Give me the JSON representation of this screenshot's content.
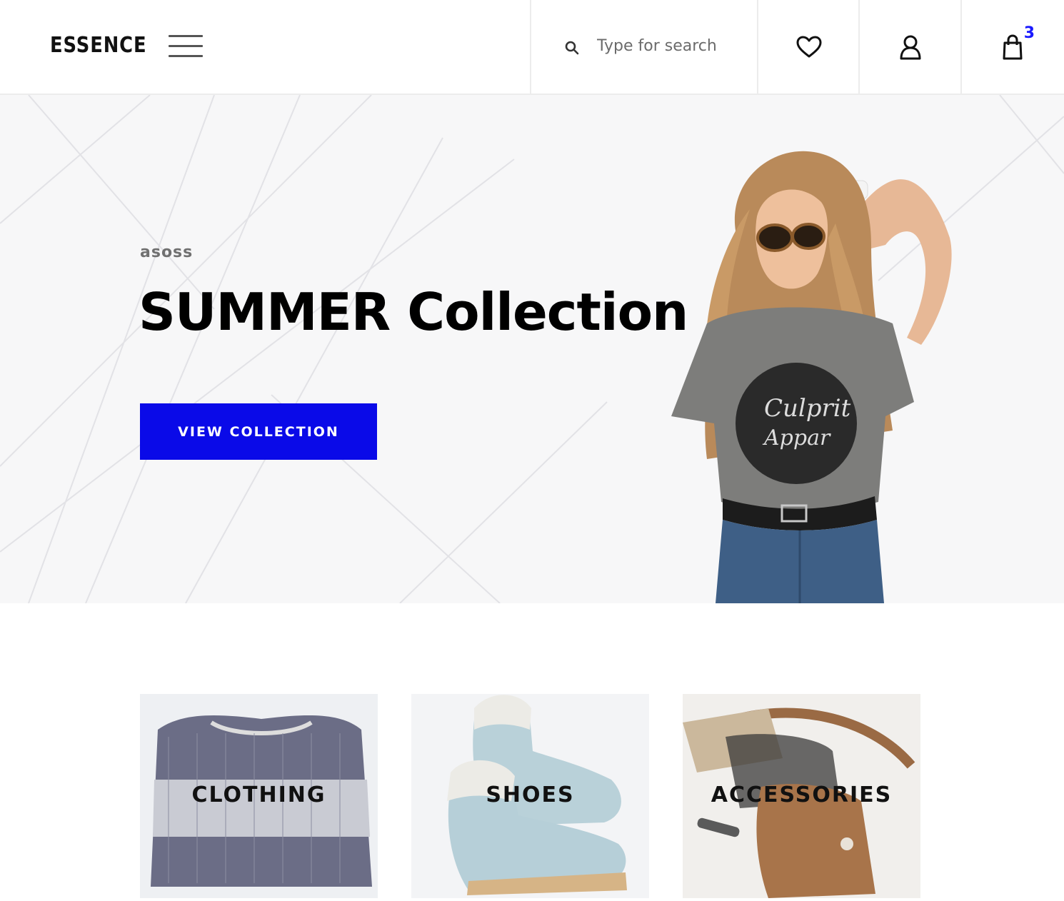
{
  "header": {
    "logo": "ESSENCE",
    "search": {
      "placeholder": "Type for search"
    },
    "cart_count": "3",
    "icons": [
      "menu-icon",
      "search-icon",
      "heart-icon",
      "user-icon",
      "shopping-bag-icon"
    ]
  },
  "hero": {
    "brand": "asoss",
    "title": "SUMMER Collection",
    "button_label": "VIEW COLLECTION",
    "button_color": "#0a0ae8"
  },
  "categories": [
    {
      "label": "CLOTHING"
    },
    {
      "label": "SHOES"
    },
    {
      "label": "ACCESSORIES"
    }
  ],
  "colors": {
    "accent": "#0a0ae8",
    "cart_badge": "#1a1aff"
  }
}
